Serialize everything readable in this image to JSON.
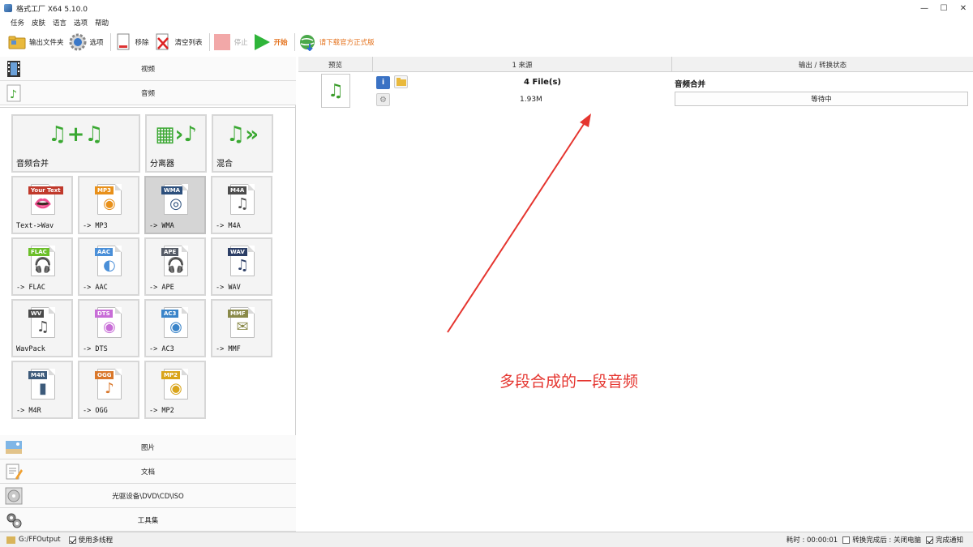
{
  "window": {
    "title": "格式工厂 X64 5.10.0",
    "controls": [
      "minimize",
      "maximize",
      "close"
    ]
  },
  "menu": [
    "任务",
    "皮肤",
    "语言",
    "选项",
    "帮助"
  ],
  "toolbar": {
    "output_folder": "输出文件夹",
    "options": "选项",
    "remove": "移除",
    "clear_list": "清空列表",
    "stop": "停止",
    "start": "开始",
    "download": "请下载官方正式版"
  },
  "categories_top": {
    "video": "视频",
    "audio": "音频"
  },
  "audio_tiles": [
    {
      "label": "音频合并",
      "badge": "",
      "badge_color": "",
      "glyph": "♫+♫",
      "selected": false
    },
    {
      "label": "分离器",
      "badge": "",
      "badge_color": "",
      "glyph": "▦›♪",
      "selected": false
    },
    {
      "label": "混合",
      "badge": "",
      "badge_color": "",
      "glyph": "♫»",
      "selected": false
    },
    {
      "label": "Text->Wav",
      "badge": "Your Text",
      "badge_color": "#c0392b",
      "glyph": "👄",
      "selected": false
    },
    {
      "label": "-> MP3",
      "badge": "MP3",
      "badge_color": "#e8901a",
      "glyph": "◉",
      "selected": false
    },
    {
      "label": "-> WMA",
      "badge": "WMA",
      "badge_color": "#2c4f7c",
      "glyph": "◎",
      "selected": true
    },
    {
      "label": "-> M4A",
      "badge": "M4A",
      "badge_color": "#4d4d4d",
      "glyph": "♫",
      "selected": false
    },
    {
      "label": "-> FLAC",
      "badge": "FLAC",
      "badge_color": "#6cbf2a",
      "glyph": "🎧",
      "selected": false
    },
    {
      "label": "-> AAC",
      "badge": "AAC",
      "badge_color": "#4a8fd8",
      "glyph": "◐",
      "selected": false
    },
    {
      "label": "-> APE",
      "badge": "APE",
      "badge_color": "#555b66",
      "glyph": "🎧",
      "selected": false
    },
    {
      "label": "-> WAV",
      "badge": "WAV",
      "badge_color": "#2c3e66",
      "glyph": "♫",
      "selected": false
    },
    {
      "label": "WavPack",
      "badge": "WV",
      "badge_color": "#4a4a4a",
      "glyph": "♫",
      "selected": false
    },
    {
      "label": "-> DTS",
      "badge": "DTS",
      "badge_color": "#c86dd7",
      "glyph": "◉",
      "selected": false
    },
    {
      "label": "-> AC3",
      "badge": "AC3",
      "badge_color": "#3a84c9",
      "glyph": "◉",
      "selected": false
    },
    {
      "label": "-> MMF",
      "badge": "MMF",
      "badge_color": "#8a8a4a",
      "glyph": "✉",
      "selected": false
    },
    {
      "label": "-> M4R",
      "badge": "M4R",
      "badge_color": "#3c5a7a",
      "glyph": "▮",
      "selected": false
    },
    {
      "label": "-> OGG",
      "badge": "OGG",
      "badge_color": "#d9772a",
      "glyph": "♪",
      "selected": false
    },
    {
      "label": "-> MP2",
      "badge": "MP2",
      "badge_color": "#d9a41a",
      "glyph": "◉",
      "selected": false
    }
  ],
  "categories_bottom": {
    "picture": "图片",
    "document": "文档",
    "disc": "光驱设备\\DVD\\CD\\ISO",
    "tools": "工具集"
  },
  "task_table": {
    "headers": {
      "preview": "预览",
      "source": "1 来源",
      "output": "输出 / 转换状态"
    },
    "rows": [
      {
        "file_count": "4 File(s)",
        "size": "1.93M",
        "output_name": "音频合并",
        "status": "等待中"
      }
    ]
  },
  "annotation": "多段合成的一段音频",
  "statusbar": {
    "output_path": "G:/FFOutput",
    "multithread": "使用多线程",
    "multithread_checked": true,
    "elapsed": "耗时 : 00:00:01",
    "after_done": "转换完成后 : 关闭电脑",
    "after_done_checked": false,
    "notify": "完成通知",
    "notify_checked": true
  }
}
